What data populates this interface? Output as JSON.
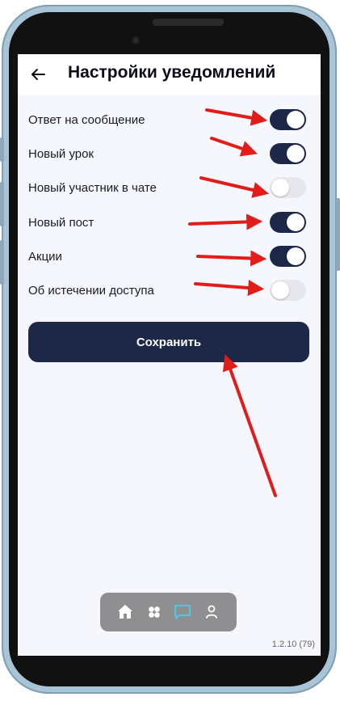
{
  "header": {
    "title": "Настройки уведомлений"
  },
  "settings": [
    {
      "label": "Ответ на сообщение",
      "enabled": true
    },
    {
      "label": "Новый урок",
      "enabled": true
    },
    {
      "label": "Новый участник в чате",
      "enabled": false
    },
    {
      "label": "Новый пост",
      "enabled": true
    },
    {
      "label": "Акции",
      "enabled": true
    },
    {
      "label": "Об истечении доступа",
      "enabled": false
    }
  ],
  "save_button": {
    "label": "Сохранить"
  },
  "nav": {
    "items": [
      {
        "icon": "home-icon"
      },
      {
        "icon": "apps-icon"
      },
      {
        "icon": "chat-icon",
        "active": true
      },
      {
        "icon": "profile-icon"
      }
    ]
  },
  "version": "1.2.10 (79)",
  "colors": {
    "primary": "#1d2748",
    "active_nav": "#4ec9df",
    "annotation": "#e21b1b"
  }
}
